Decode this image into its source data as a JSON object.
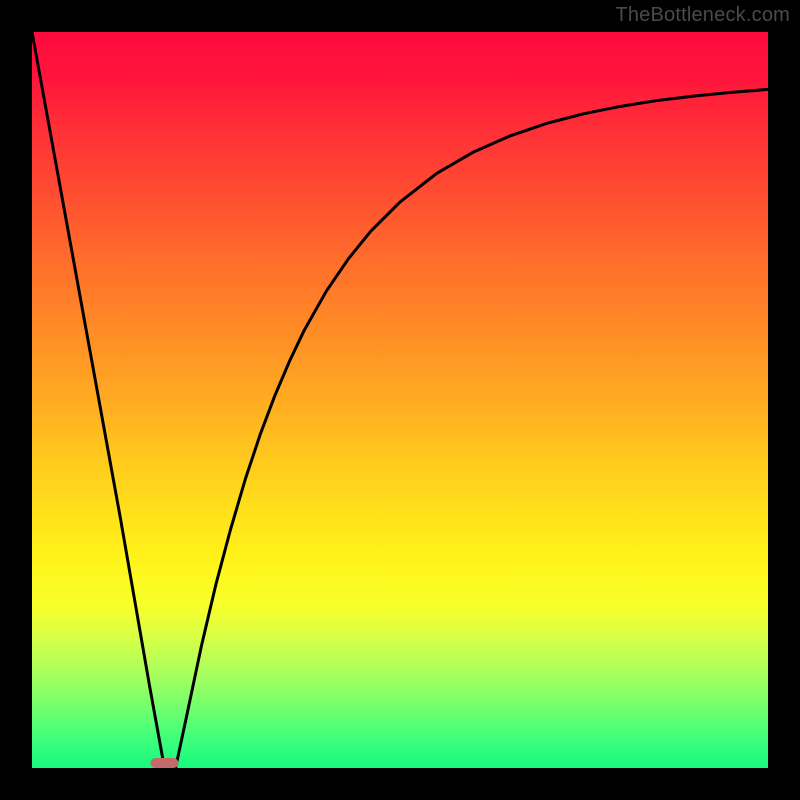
{
  "watermark": "TheBottleneck.com",
  "chart_data": {
    "type": "line",
    "title": "",
    "xlabel": "",
    "ylabel": "",
    "xlim": [
      0,
      100
    ],
    "ylim": [
      0,
      100
    ],
    "grid": false,
    "annotations": [],
    "marker": {
      "x": 18,
      "y": 0,
      "color": "#c36a6a"
    },
    "series": [
      {
        "name": "curve",
        "x": [
          0,
          2,
          4,
          6,
          8,
          10,
          12,
          14,
          16,
          18,
          19.5,
          21,
          23,
          25,
          27,
          29,
          31,
          33,
          35,
          37,
          40,
          43,
          46,
          50,
          55,
          60,
          65,
          70,
          75,
          80,
          85,
          90,
          95,
          100
        ],
        "y": [
          100,
          89,
          78,
          67,
          56,
          45,
          34,
          22.5,
          11,
          0,
          0,
          7,
          16.5,
          25,
          32.5,
          39.3,
          45.3,
          50.6,
          55.3,
          59.5,
          64.8,
          69.2,
          72.9,
          76.9,
          80.8,
          83.7,
          85.9,
          87.6,
          88.9,
          89.9,
          90.7,
          91.3,
          91.8,
          92.2
        ]
      }
    ]
  }
}
